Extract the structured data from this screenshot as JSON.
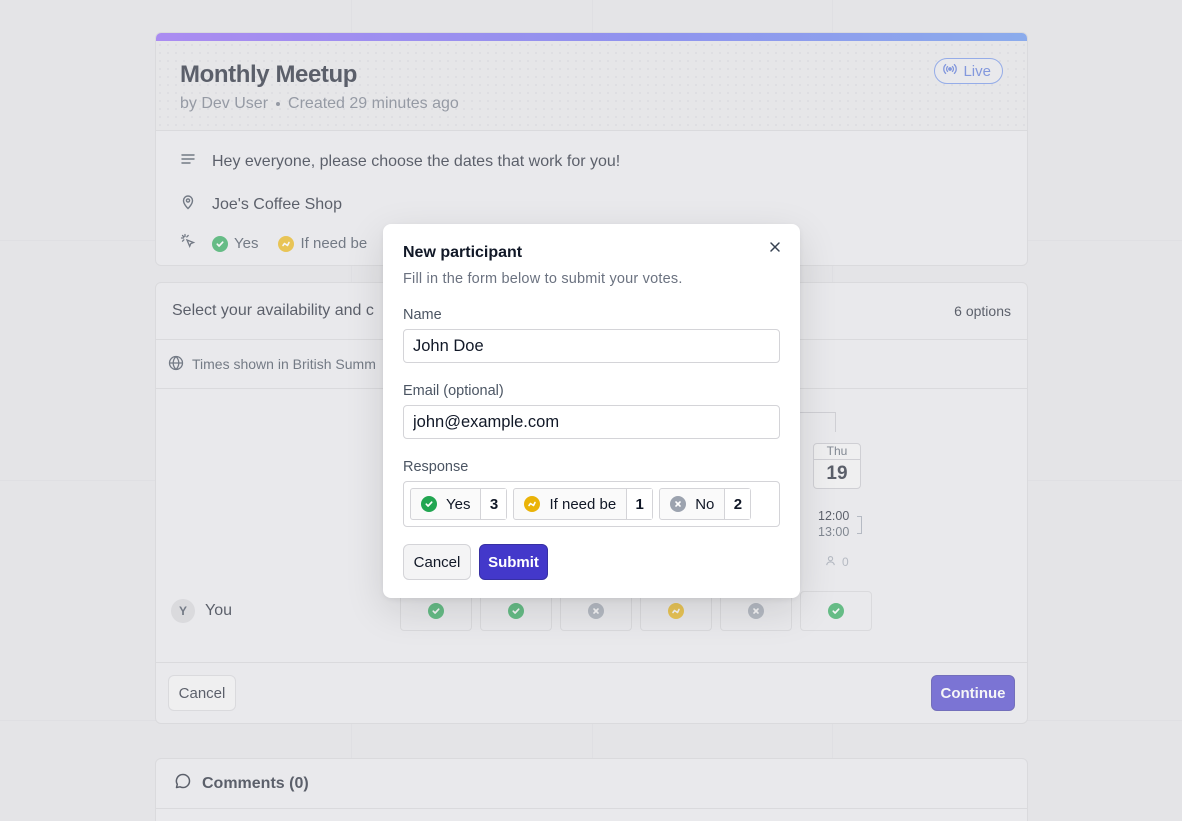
{
  "poll": {
    "title": "Monthly Meetup",
    "author": "by Dev User",
    "created": "Created 29 minutes ago",
    "live_label": "Live",
    "description": "Hey everyone, please choose the dates that work for you!",
    "location": "Joe's Coffee Shop",
    "legend": {
      "yes": "Yes",
      "if_need_be": "If need be"
    }
  },
  "availability": {
    "heading": "Select your availability and c",
    "options_count": "6 options",
    "timezone": "Times shown in British Summ",
    "visible_date": {
      "day_of_week": "Thu",
      "day": "19"
    },
    "visible_time": {
      "start": "12:00",
      "end": "13:00"
    },
    "participant_count": "0",
    "you_row": {
      "avatar_letter": "Y",
      "name": "You",
      "votes": [
        "yes",
        "yes",
        "no",
        "if-need-be",
        "no",
        "yes"
      ]
    },
    "cancel_label": "Cancel",
    "continue_label": "Continue"
  },
  "comments": {
    "heading": "Comments (0)"
  },
  "modal": {
    "title": "New participant",
    "description": "Fill in the form below to submit your votes.",
    "name_label": "Name",
    "name_value": "John Doe",
    "email_label": "Email (optional)",
    "email_value": "john@example.com",
    "response_label": "Response",
    "responses": [
      {
        "label": "Yes",
        "count": "3"
      },
      {
        "label": "If need be",
        "count": "1"
      },
      {
        "label": "No",
        "count": "2"
      }
    ],
    "cancel_label": "Cancel",
    "submit_label": "Submit"
  },
  "colors": {
    "accent": "#4338ca",
    "yes": "#22a652",
    "if_need_be": "#eab308",
    "no": "#9ca3af",
    "live": "#4f6fd8"
  }
}
